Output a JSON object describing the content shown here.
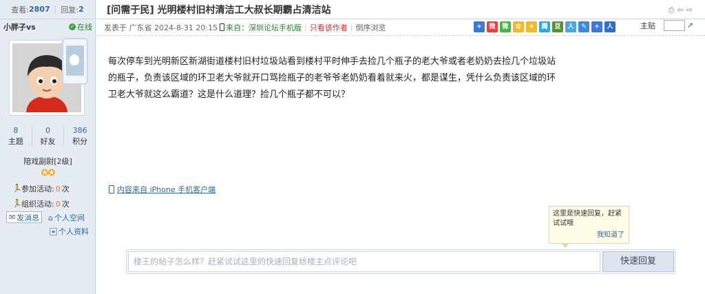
{
  "sidebar": {
    "views_label": "查看:",
    "views_value": "2807",
    "replies_label": "回复:",
    "replies_value": "2",
    "username": "小胖子vs",
    "status": "在线",
    "counts": [
      {
        "value": "8",
        "label": "主题"
      },
      {
        "value": "0",
        "label": "好友"
      },
      {
        "value": "386",
        "label": "积分"
      }
    ],
    "rank": "陪戏副尉[2级]",
    "rank_stars": 2,
    "activities": [
      {
        "label": "参加活动:",
        "count": "0",
        "unit": "次"
      },
      {
        "label": "组织活动:",
        "count": "0",
        "unit": "次"
      }
    ],
    "send_message": "发消息",
    "personal_space": "个人空间",
    "personal_profile": "个人资料"
  },
  "post": {
    "title_prefix": "[问需于民]",
    "title": "光明楼村旧村清洁工大叔长期霸占清洁站",
    "meta_posted": "发表于 广东省 2024-8-31 20:15",
    "meta_source": "来自：深圳论坛手机版",
    "meta_only_author": "只看该作者",
    "meta_reverse": "倒序浏览",
    "floor_label": "主贴",
    "body": "每次停车到光明新区新湖街道楼村旧村垃圾站看到楼村平时伸手去捡几个瓶子的老大爷或者老奶奶去捡几个垃圾站的瓶子，负责该区域的环卫老大爷就开口骂捡瓶子的老爷爷老奶奶看着就来火，都是谋生，凭什么负责该区域的环卫老大爷就这么霸道？这是什么道理？捡几个瓶子都不可以？",
    "client_link": "内容来自 iPhone 手机客户端"
  },
  "tip": {
    "text": "这里是快速回复，赶紧试试哦",
    "dismiss": "我知道了"
  },
  "reply": {
    "placeholder": "楼王的帖子怎么样？赶紧试试这里的快速回复给楼主点评论吧",
    "button": "快速回复"
  }
}
